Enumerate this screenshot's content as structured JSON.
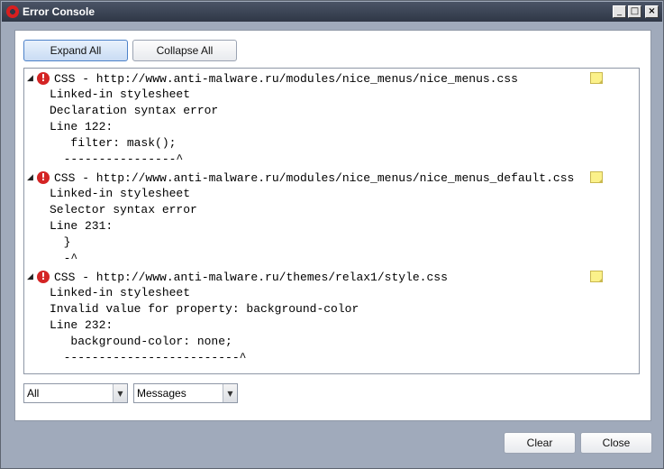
{
  "window": {
    "title": "Error Console",
    "minimize": "_",
    "maximize": "□",
    "close": "×"
  },
  "toolbar": {
    "expand_all": "Expand All",
    "collapse_all": "Collapse All"
  },
  "entries": [
    {
      "title": "CSS - http://www.anti-malware.ru/modules/nice_menus/nice_menus.css",
      "lines": [
        "Linked-in stylesheet",
        "Declaration syntax error",
        "Line 122:",
        "   filter: mask();",
        "  ----------------^"
      ]
    },
    {
      "title": "CSS - http://www.anti-malware.ru/modules/nice_menus/nice_menus_default.css",
      "lines": [
        "Linked-in stylesheet",
        "Selector syntax error",
        "Line 231:",
        "  }",
        "  -^"
      ]
    },
    {
      "title": "CSS - http://www.anti-malware.ru/themes/relax1/style.css",
      "lines": [
        "Linked-in stylesheet",
        "Invalid value for property: background-color",
        "Line 232:",
        "   background-color: none;",
        "  -------------------------^"
      ]
    }
  ],
  "filters": {
    "source": "All",
    "type": "Messages"
  },
  "footer": {
    "clear": "Clear",
    "close": "Close"
  }
}
